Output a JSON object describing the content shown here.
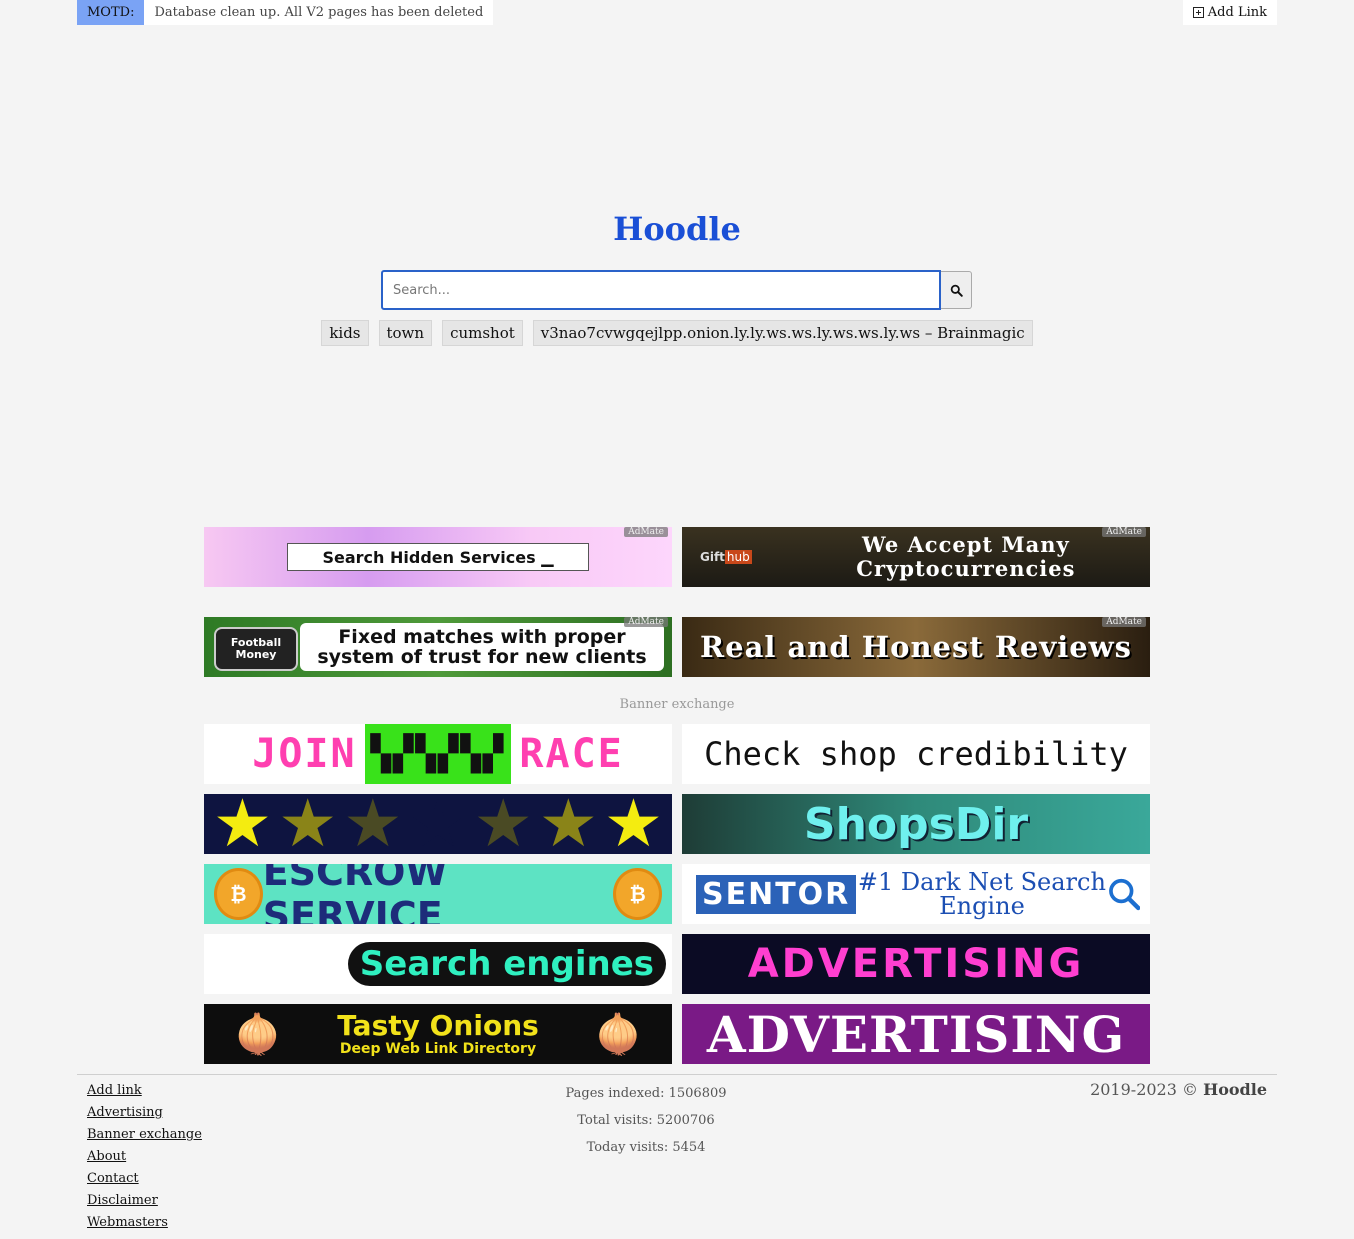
{
  "motd": {
    "label": "MOTD:",
    "text": "Database clean up. All V2 pages has been deleted"
  },
  "top_add_link": "Add Link",
  "logo": "Hoodle",
  "search": {
    "placeholder": "Search..."
  },
  "tags": [
    "kids",
    "town",
    "cumshot",
    "v3nao7cvwgqejlpp.onion.ly.ly.ws.ws.ly.ws.ws.ly.ws – Brainmagic"
  ],
  "ads": {
    "badge": "AdMate",
    "hidden_services": "Search Hidden Services ▁",
    "crypto_brand_a": "Gift",
    "crypto_brand_b": "hub",
    "crypto_text": "We Accept Many Cryptocurrencies",
    "football_badge": "Football Money",
    "football_text": "Fixed matches with proper system of trust for new clients",
    "reviews_text": "Real and Honest Reviews"
  },
  "banner_exchange": {
    "label": "Banner exchange",
    "join": [
      "JOIN",
      "RACE"
    ],
    "check": "Check shop credibility",
    "shops": "ShopsDir",
    "escrow": "ESCROW SERVICE",
    "sentor_logo": "SENTOR",
    "sentor_text": "#1 Dark Net Search Engine",
    "engines": "Search engines",
    "advertising1": "ADVERTISING",
    "tasty_title": "Tasty Onions",
    "tasty_sub": "Deep Web Link Directory",
    "advertising2": "ADVERTISING"
  },
  "footer": {
    "links": [
      "Add link",
      "Advertising",
      "Banner exchange",
      "About",
      "Contact",
      "Disclaimer",
      "Webmasters"
    ],
    "pages_indexed": "Pages indexed: 1506809",
    "total_visits": "Total visits: 5200706",
    "today_visits": "Today visits: 5454",
    "copyright_years": "2019-2023 ©",
    "copyright_brand": "Hoodle"
  },
  "colors": {
    "accent": "#1a4fd6",
    "motd_label": "#7aa3f5",
    "background": "#f4f4f4"
  }
}
